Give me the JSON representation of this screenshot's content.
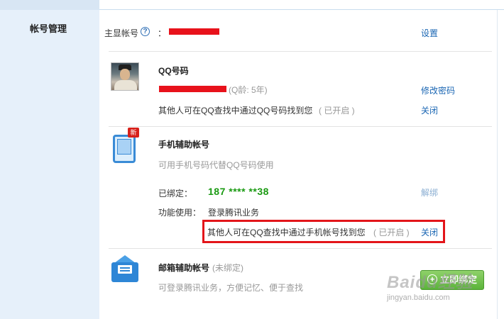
{
  "sidebar": {
    "title": "帐号管理"
  },
  "primary_account": {
    "label": "主显帐号",
    "colon": "：",
    "action_label": "设置"
  },
  "qq_section": {
    "title": "QQ号码",
    "qq_age": "(Q龄: 5年)",
    "change_password_label": "修改密码",
    "search_description": "其他人可在QQ查找中通过QQ号码找到您",
    "search_status": "( 已开启 )",
    "close_label": "关闭"
  },
  "mobile_section": {
    "badge": "新",
    "title": "手机辅助帐号",
    "description": "可用手机号码代替QQ号码使用",
    "bound_label": "已绑定：",
    "phone_number": "187 **** **38",
    "unbind_label": "解绑",
    "function_label": "功能使用：",
    "function_value": "登录腾讯业务",
    "search_description": "其他人可在QQ查找中通过手机帐号找到您",
    "search_status": "( 已开启 )",
    "close_label": "关闭"
  },
  "email_section": {
    "title": "邮箱辅助帐号",
    "status": "(未绑定)",
    "description": "可登录腾讯业务，方便记忆、便于查找",
    "bind_plus": "+",
    "bind_label": "立即绑定"
  },
  "watermark": {
    "logo": "Baidu经验",
    "url": "jingyan.baidu.com"
  },
  "colors": {
    "link": "#1a66b3",
    "phone_number": "#1a9a12",
    "highlight": "#e3151a",
    "redaction": "#e8121b"
  }
}
